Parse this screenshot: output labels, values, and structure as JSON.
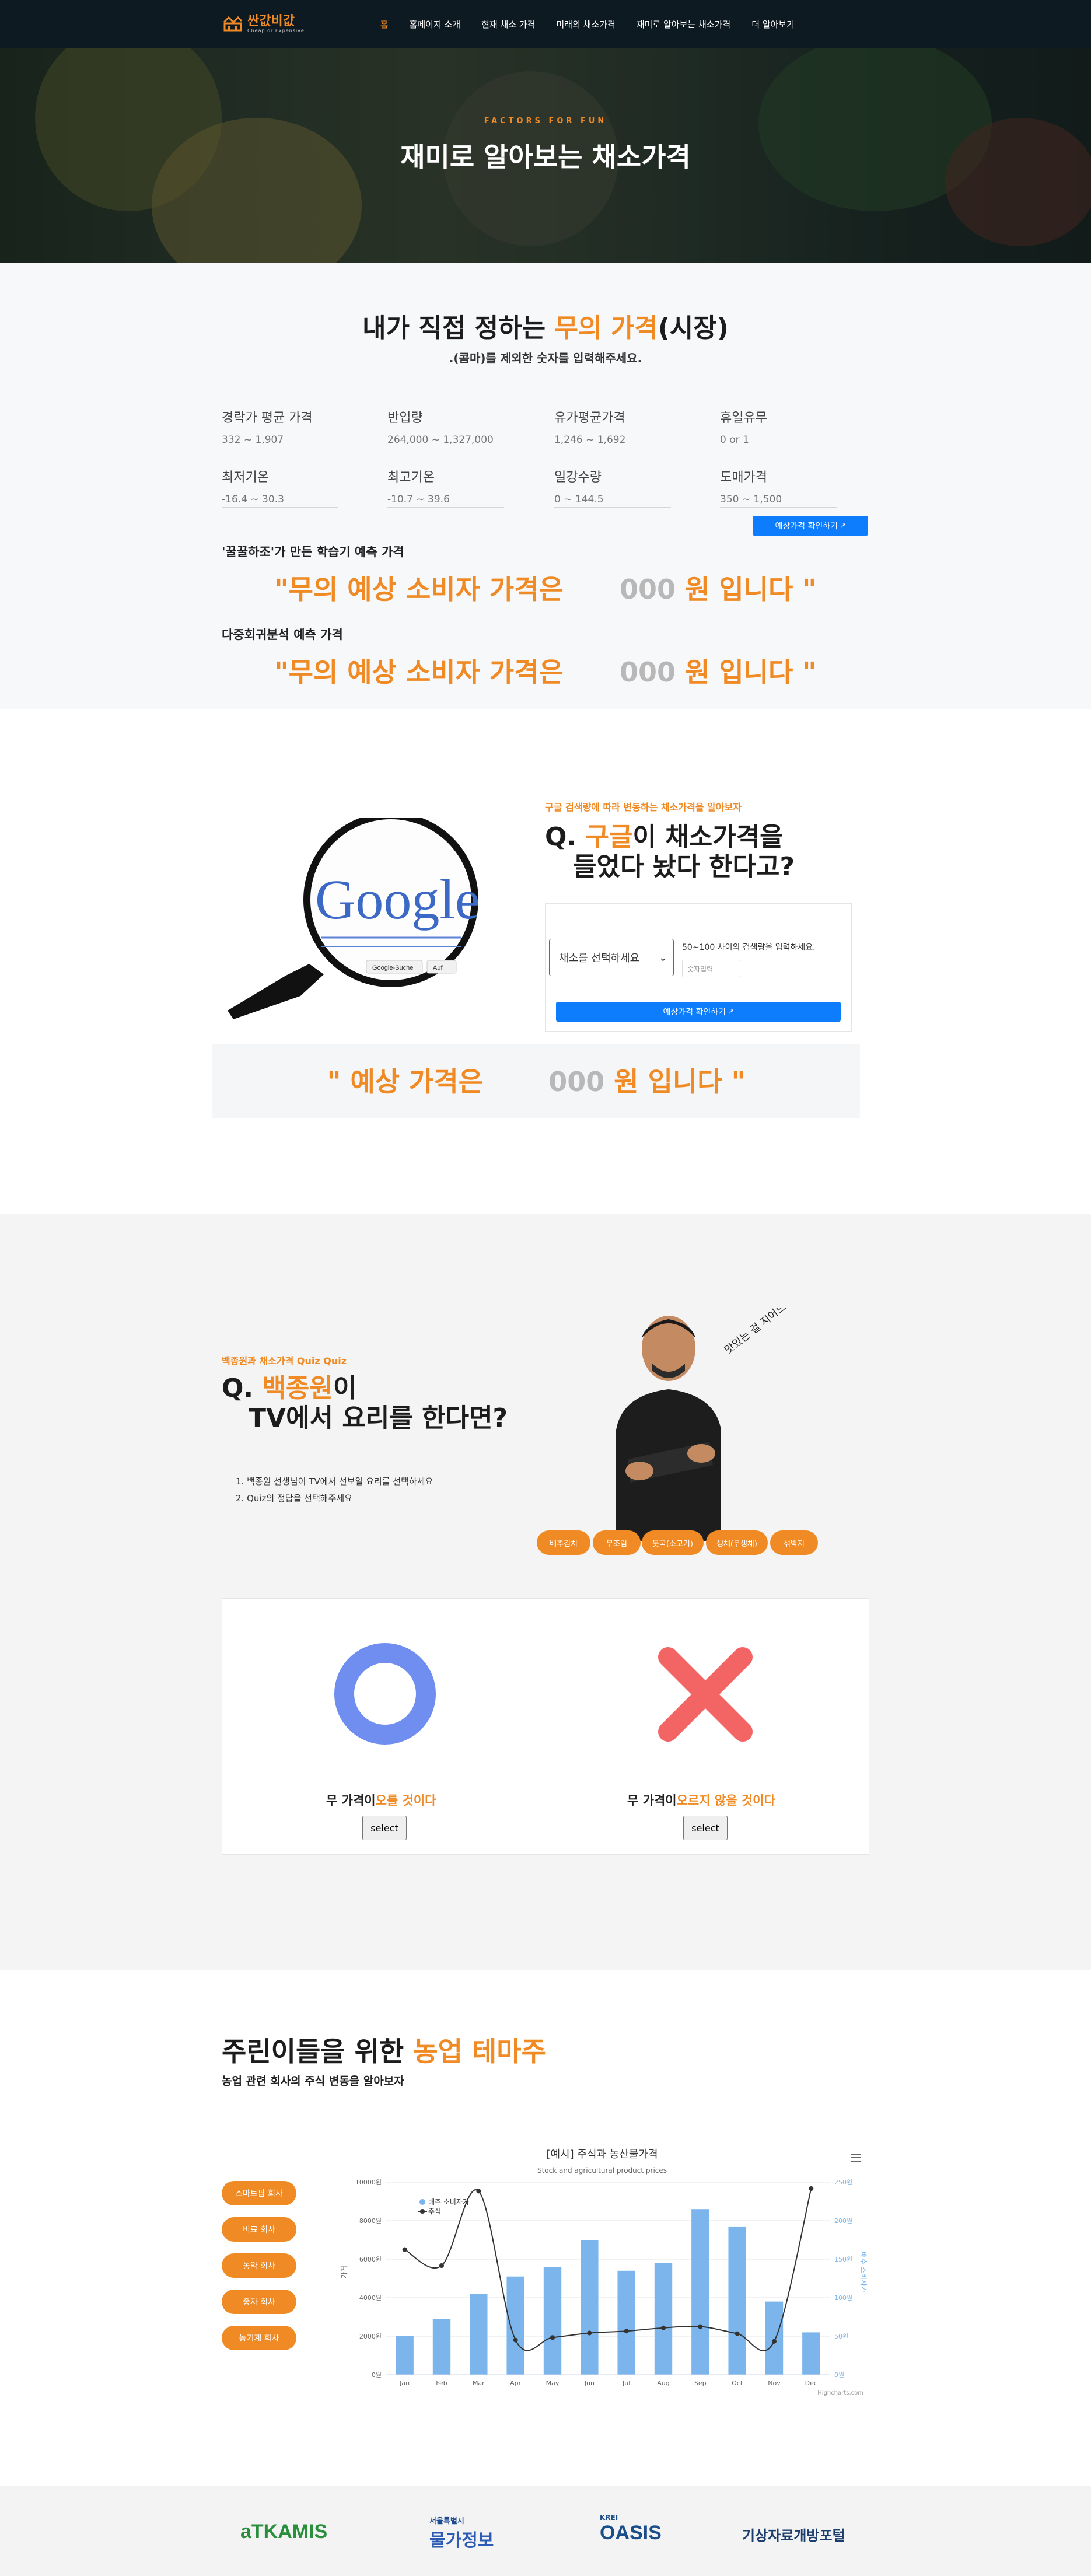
{
  "nav": {
    "logo_title": "싼값비값",
    "logo_sub": "Cheap or Expensive",
    "items": [
      "홈",
      "홈페이지 소개",
      "현재 채소 가격",
      "미래의 채소가격",
      "재미로 알아보는 채소가격",
      "더 알아보기"
    ]
  },
  "hero": {
    "kicker": "FACTORS FOR FUN",
    "title": "재미로 알아보는 채소가격"
  },
  "section1": {
    "title_pre": "내가 직접 정하는 ",
    "title_hl": "무의 가격",
    "title_post": "(시장)",
    "subtitle": ".(콤마)를 제외한 숫자를 입력해주세요.",
    "fields": [
      {
        "label": "경락가 평균 가격",
        "placeholder": "332 ~ 1,907"
      },
      {
        "label": "반입량",
        "placeholder": "264,000 ~ 1,327,000"
      },
      {
        "label": "유가평균가격",
        "placeholder": "1,246 ~ 1,692"
      },
      {
        "label": "휴일유무",
        "placeholder": "0 or 1"
      },
      {
        "label": "최저기온",
        "placeholder": "-16.4 ~ 30.3"
      },
      {
        "label": "최고기온",
        "placeholder": "-10.7 ~ 39.6"
      },
      {
        "label": "일강수량",
        "placeholder": "0 ~ 144.5"
      },
      {
        "label": "도매가격",
        "placeholder": "350 ~ 1,500"
      }
    ],
    "button": "예상가격 확인하기",
    "model1_label": "'꿀꿀하조'가 만든 학습기 예측 가격",
    "model2_label": "다중회귀분석 예측 가격",
    "pred_pre": "\"무의 예상 소비자 가격은",
    "pred_num": "000",
    "pred_post": "원 입니다 \""
  },
  "section2": {
    "kicker": "구글 검색량에 따라 변동하는 채소가격을 알아보자",
    "q_mark": "Q.",
    "q_hl": "구글",
    "q_line1": "이 채소가격을",
    "q_line2": "들었다 놨다 한다고?",
    "select_placeholder": "채소를 선택하세요",
    "hint": "50~100 사이의 검색량을 입력하세요.",
    "input_placeholder": "숫자입력",
    "button": "예상가격 확인하기",
    "google_word": "Google",
    "google_btn1": "Google-Suche",
    "google_btn2": "Auf",
    "pred_pre": "\" 예상 가격은",
    "pred_num": "000",
    "pred_post": "원 입니다 \""
  },
  "section3": {
    "kicker": "백종원과 채소가격 Quiz Quiz",
    "q_mark": "Q.",
    "q_hl": "백종원",
    "q_line1": "이",
    "q_line2": "TV에서 요리를 한다면?",
    "steps": [
      "1. 백종원 선생님이 TV에서 선보일 요리를 선택하세요",
      "2. Quiz의 정답을 선택해주세요"
    ],
    "chips": [
      "배추김치",
      "무조림",
      "뭇국(소고기)",
      "생채(무생채)",
      "섞박지"
    ],
    "signature": "맛있는 걸 지어드릴게",
    "o_label_pre": "무 가격이",
    "o_label_hl": "오를 것이다",
    "x_label_pre": "무 가격이",
    "x_label_hl": "오르지 않을 것이다",
    "select": "select",
    "colors": {
      "o": "#6f8ef0",
      "x": "#f36464"
    }
  },
  "section4": {
    "title_pre": "주린이들을 위한 ",
    "title_hl": "농업 테마주",
    "subtitle": "농업 관련 회사의 주식 변동을 알아보자",
    "companies": [
      "스마트팜 회사",
      "비료 회사",
      "농약 회사",
      "종자 회사",
      "농기계 회사"
    ]
  },
  "chart_data": {
    "type": "bar",
    "title": "[예시] 주식과 농산물가격",
    "subtitle": "Stock and agricultural product prices",
    "categories": [
      "Jan",
      "Feb",
      "Mar",
      "Apr",
      "May",
      "Jun",
      "Jul",
      "Aug",
      "Sep",
      "Oct",
      "Nov",
      "Dec"
    ],
    "series": [
      {
        "name": "배추 소비자가",
        "type": "bar",
        "axis": "left",
        "values": [
          2000,
          2900,
          4200,
          5100,
          5600,
          7000,
          5400,
          5800,
          8600,
          7700,
          3800,
          2200
        ],
        "color": "#7cb5ec"
      },
      {
        "name": "주식",
        "type": "spline",
        "axis": "right",
        "values": [
          195,
          170,
          286,
          54,
          58,
          65,
          68,
          73,
          75,
          64,
          52,
          290
        ],
        "color": "#333333"
      }
    ],
    "ylim_left": [
      0,
      10000
    ],
    "ylim_right": [
      0,
      300
    ],
    "yticks_left": [
      "0원",
      "2000원",
      "4000원",
      "6000원",
      "8000원",
      "10000원"
    ],
    "yticks_right": [
      "0원",
      "50원",
      "100원",
      "150원",
      "200원",
      "250원"
    ],
    "ylabel_left": "가격",
    "ylabel_right": "배추 소비자가",
    "credits": "Highcharts.com",
    "legend": "top-left",
    "grid": true
  },
  "footer": {
    "logos": [
      "aTKAMIS",
      "물가정보",
      "OASIS",
      "기상자료개방포털"
    ],
    "logo_small": [
      "",
      "서울특별시",
      "KREI",
      ""
    ]
  }
}
